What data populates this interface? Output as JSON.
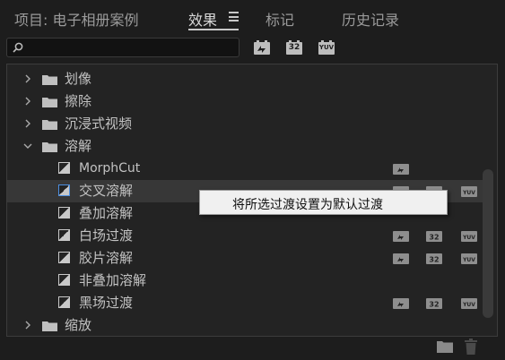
{
  "tabs": {
    "project": "项目: 电子相册案例",
    "effects": "效果",
    "markers": "标记",
    "history": "历史记录"
  },
  "search": {
    "value": "",
    "placeholder": ""
  },
  "filter_buttons": {
    "accelerated": "accelerated-effects-icon",
    "bit32": "32",
    "yuv": "YUV"
  },
  "tree": [
    {
      "label": "划像",
      "expanded": false
    },
    {
      "label": "擦除",
      "expanded": false
    },
    {
      "label": "沉浸式视频",
      "expanded": false
    },
    {
      "label": "溶解",
      "expanded": true
    },
    {
      "label": "MorphCut",
      "child": true
    },
    {
      "label": "交叉溶解",
      "child": true,
      "selected": true
    },
    {
      "label": "叠加溶解",
      "child": true
    },
    {
      "label": "白场过渡",
      "child": true
    },
    {
      "label": "胶片溶解",
      "child": true
    },
    {
      "label": "非叠加溶解",
      "child": true
    },
    {
      "label": "黑场过渡",
      "child": true
    },
    {
      "label": "缩放",
      "expanded": false
    }
  ],
  "badge_labels": {
    "bit32": "32",
    "yuv": "YUV"
  },
  "context_menu": {
    "item": "将所选过渡设置为默认过渡"
  },
  "colors": {
    "background": "#1d1d1d",
    "panel": "#232323",
    "selected_row": "#373737",
    "selection_border": "#4d8fe0",
    "menu_bg": "#f0f0f0"
  }
}
